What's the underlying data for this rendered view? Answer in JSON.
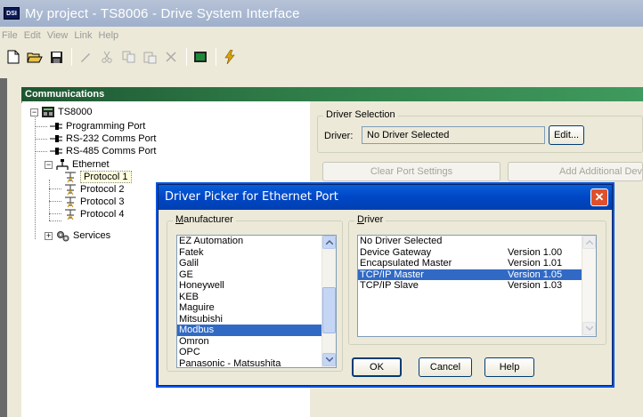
{
  "window": {
    "icon_text": "DSI",
    "title": "My project - TS8006 - Drive System Interface"
  },
  "menu": [
    "File",
    "Edit",
    "View",
    "Link",
    "Help"
  ],
  "toolbar": {
    "icons": [
      "new-icon",
      "open-icon",
      "save-icon",
      "edit-icon",
      "cut-icon",
      "copy-icon",
      "paste-icon",
      "delete-icon",
      "monitor-icon",
      "lightning-icon"
    ]
  },
  "communications": {
    "header": "Communications",
    "tree": {
      "root": "TS8000",
      "programming_port": "Programming Port",
      "rs232": "RS-232 Comms Port",
      "rs485": "RS-485 Comms Port",
      "ethernet": "Ethernet",
      "protocols": [
        "Protocol 1",
        "Protocol 2",
        "Protocol 3",
        "Protocol 4"
      ],
      "services": "Services"
    }
  },
  "driver_selection": {
    "group_label": "Driver Selection",
    "driver_label": "Driver:",
    "driver_value": "No Driver Selected",
    "edit_button": "Edit...",
    "clear_button": "Clear Port Settings",
    "add_button": "Add Additional Dev"
  },
  "dialog": {
    "title": "Driver Picker for Ethernet Port",
    "close_symbol": "✕",
    "manufacturer_label_u": "M",
    "manufacturer_label_rest": "anufacturer",
    "manufacturers": [
      "EZ Automation",
      "Fatek",
      "Galil",
      "GE",
      "Honeywell",
      "KEB",
      "Maguire",
      "Mitsubishi",
      "Modbus",
      "Omron",
      "OPC",
      "Panasonic - Matsushita"
    ],
    "selected_manufacturer": "Modbus",
    "driver_label_u": "D",
    "driver_label_rest": "river",
    "drivers": [
      {
        "name": "No Driver Selected",
        "version": ""
      },
      {
        "name": "Device Gateway",
        "version": "Version 1.00"
      },
      {
        "name": "Encapsulated Master",
        "version": "Version 1.01"
      },
      {
        "name": "TCP/IP Master",
        "version": "Version 1.05"
      },
      {
        "name": "TCP/IP Slave",
        "version": "Version 1.03"
      }
    ],
    "selected_driver": "TCP/IP Master",
    "ok_button": "OK",
    "cancel_button": "Cancel",
    "help_button": "Help"
  },
  "colors": {
    "selection": "#316ac5",
    "dialog_title": "#0048c8",
    "comm_header": "#2e7a47"
  }
}
